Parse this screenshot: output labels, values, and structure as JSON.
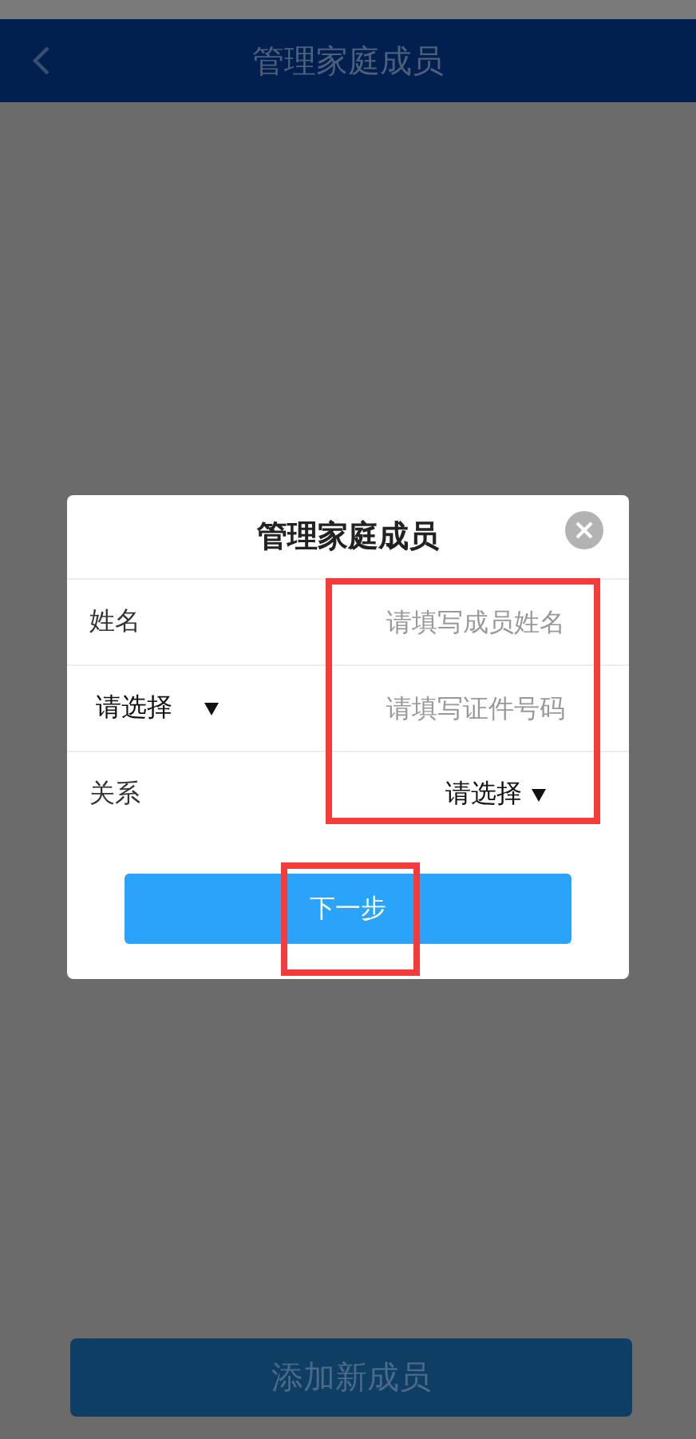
{
  "header": {
    "title": "管理家庭成员"
  },
  "dialog": {
    "title": "管理家庭成员",
    "rows": [
      {
        "kind": "label-input",
        "label": "姓名",
        "placeholder": "请填写成员姓名"
      },
      {
        "kind": "select-input",
        "select": "请选择",
        "placeholder": "请填写证件号码"
      },
      {
        "kind": "label-select",
        "label": "关系",
        "select": "请选择"
      }
    ],
    "button": "下一步"
  },
  "bottom_button": "添加新成员",
  "annotations": {
    "fields_highlighted": true,
    "button_highlighted": true
  }
}
